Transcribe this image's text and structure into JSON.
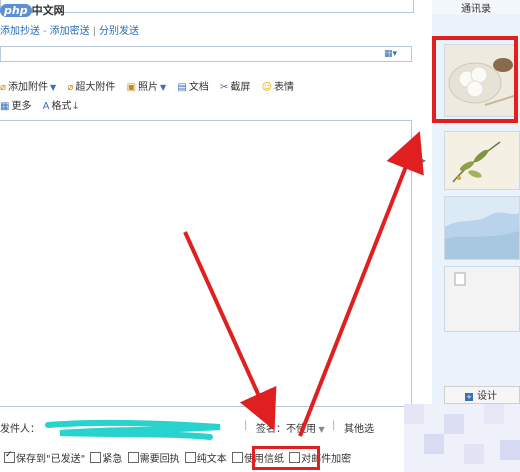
{
  "watermark": {
    "php": "php",
    "site": "中文网"
  },
  "cc_links": {
    "add_cc": "添加抄送",
    "add_bcc": "添加密送",
    "separate_send": "分别发送"
  },
  "toolbar": {
    "add_attachment": "添加附件",
    "large_attachment": "超大附件",
    "photo": "照片",
    "document": "文档",
    "screenshot": "截屏",
    "emoji": "表情",
    "more": "更多",
    "format": "格式"
  },
  "sender": {
    "label": "发件人：",
    "signature_label": "签名：不使用",
    "other_options": "其他选"
  },
  "options": {
    "save_sent": "保存到\"已发送\"",
    "urgent": "紧急",
    "receipt": "需要回执",
    "plain_text": "纯文本",
    "stationery": "使用信纸",
    "encrypt": "对邮件加密"
  },
  "right_panel": {
    "contacts_tab": "通讯录",
    "design_button": "设计"
  },
  "colors": {
    "highlight": "#e02020",
    "link": "#2a6cb3",
    "panel_bg": "#eaf2fb"
  }
}
